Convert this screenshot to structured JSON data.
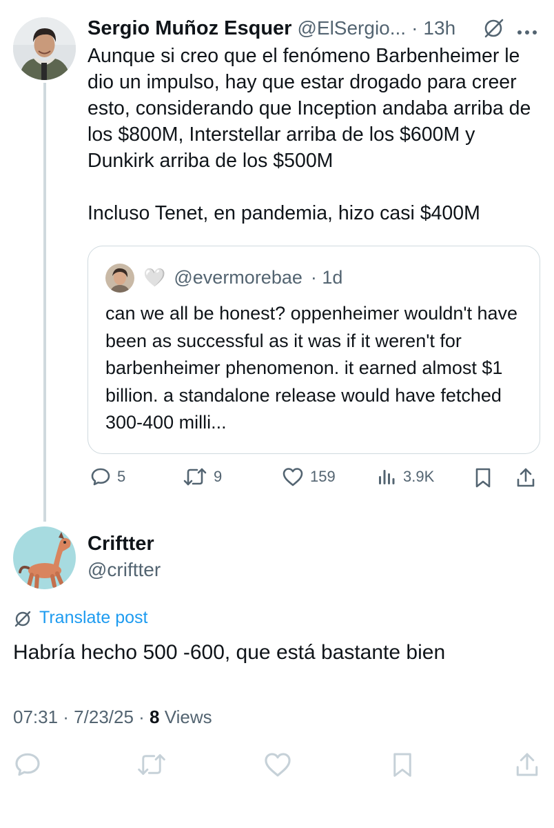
{
  "parent_tweet": {
    "author_name": "Sergio Muñoz Esquer",
    "handle": "@ElSergio...",
    "separator": "·",
    "time": "13h",
    "text": "Aunque si creo que el fenómeno Barbenheimer le dio un impulso, hay que estar drogado para creer esto, considerando que Inception andaba arriba de los $800M, Interstellar arriba de los $600M y Dunkirk arriba de los $500M\n\nIncluso Tenet, en pandemia, hizo casi $400M",
    "quote": {
      "emoji": "🤍",
      "handle": "@evermorebae",
      "time": "· 1d",
      "text": "can we all be honest? oppenheimer wouldn't have been as successful as it was if it weren't for barbenheimer phenomenon. it earned almost $1 billion. a standalone release would have fetched 300-400 milli..."
    },
    "actions": {
      "replies": "5",
      "reposts": "9",
      "likes": "159",
      "views": "3.9K"
    }
  },
  "reply_tweet": {
    "author_name": "Criftter",
    "handle": "@criftter",
    "translate_label": "Translate post",
    "text": "Habría hecho 500 -600, que está bastante bien",
    "time": "07:31 · 7/23/25 ·",
    "views_count": "8",
    "views_label": "Views"
  },
  "icons": [
    "grok-icon",
    "more-icon",
    "reply-icon",
    "repost-icon",
    "like-icon",
    "views-icon",
    "bookmark-icon",
    "share-icon",
    "translate-icon"
  ],
  "colors": {
    "text": "#0f1419",
    "muted": "#536471",
    "link": "#1d9bf0",
    "line": "#cfd9de",
    "bottom_icons": "#c6d1d8"
  }
}
